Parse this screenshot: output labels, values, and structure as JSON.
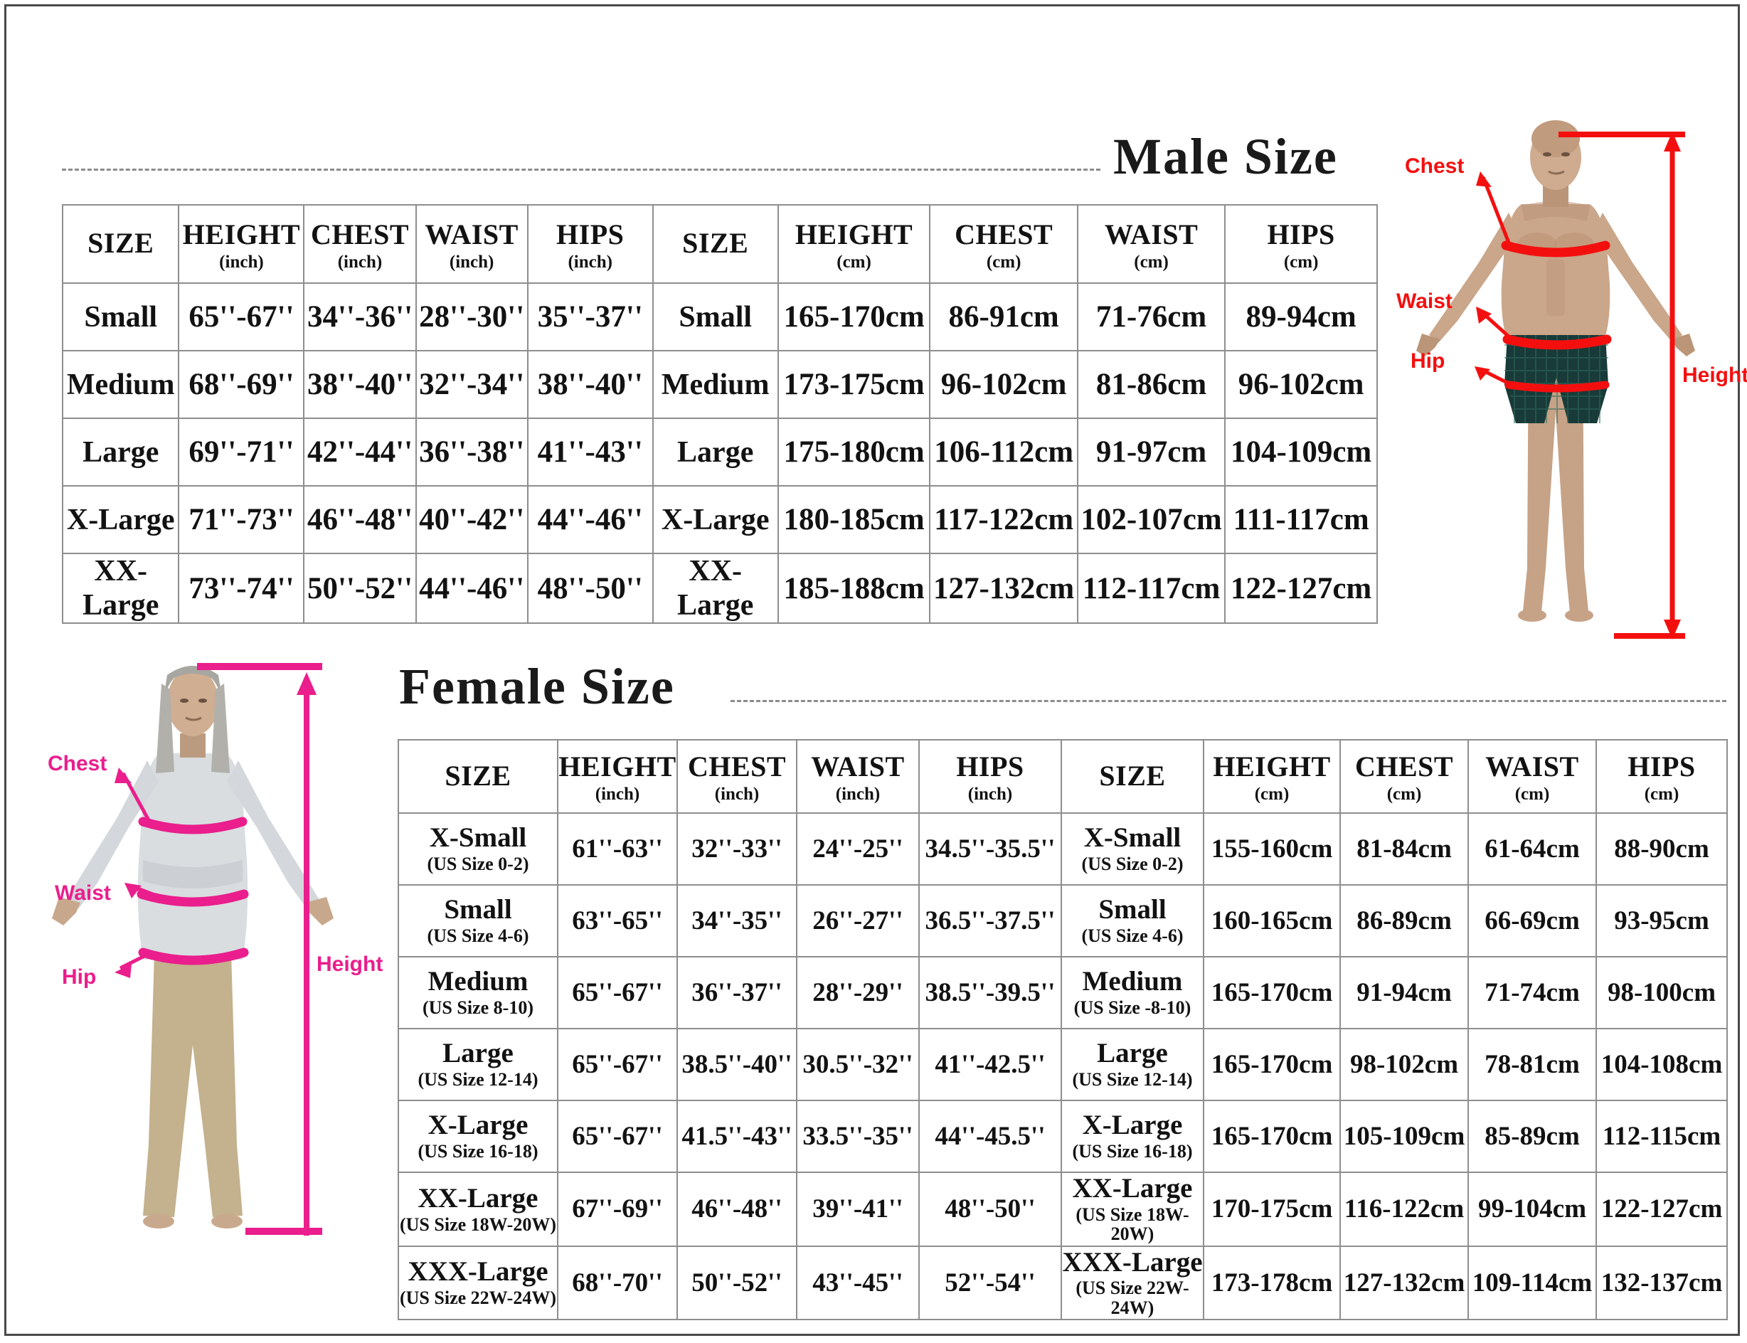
{
  "male": {
    "title": "Male Size",
    "headers_inch": [
      {
        "main": "SIZE",
        "unit": ""
      },
      {
        "main": "HEIGHT",
        "unit": "(inch)"
      },
      {
        "main": "CHEST",
        "unit": "(inch)"
      },
      {
        "main": "WAIST",
        "unit": "(inch)"
      },
      {
        "main": "HIPS",
        "unit": "(inch)"
      }
    ],
    "headers_cm": [
      {
        "main": "SIZE",
        "unit": ""
      },
      {
        "main": "HEIGHT",
        "unit": "(cm)"
      },
      {
        "main": "CHEST",
        "unit": "(cm)"
      },
      {
        "main": "WAIST",
        "unit": "(cm)"
      },
      {
        "main": "HIPS",
        "unit": "(cm)"
      }
    ],
    "rows": [
      {
        "size": "Small",
        "height_in": "65''-67''",
        "chest_in": "34''-36''",
        "waist_in": "28''-30''",
        "hips_in": "35''-37''",
        "size2": "Small",
        "height_cm": "165-170cm",
        "chest_cm": "86-91cm",
        "waist_cm": "71-76cm",
        "hips_cm": "89-94cm"
      },
      {
        "size": "Medium",
        "height_in": "68''-69''",
        "chest_in": "38''-40''",
        "waist_in": "32''-34''",
        "hips_in": "38''-40''",
        "size2": "Medium",
        "height_cm": "173-175cm",
        "chest_cm": "96-102cm",
        "waist_cm": "81-86cm",
        "hips_cm": "96-102cm"
      },
      {
        "size": "Large",
        "height_in": "69''-71''",
        "chest_in": "42''-44''",
        "waist_in": "36''-38''",
        "hips_in": "41''-43''",
        "size2": "Large",
        "height_cm": "175-180cm",
        "chest_cm": "106-112cm",
        "waist_cm": "91-97cm",
        "hips_cm": "104-109cm"
      },
      {
        "size": "X-Large",
        "height_in": "71''-73''",
        "chest_in": "46''-48''",
        "waist_in": "40''-42''",
        "hips_in": "44''-46''",
        "size2": "X-Large",
        "height_cm": "180-185cm",
        "chest_cm": "117-122cm",
        "waist_cm": "102-107cm",
        "hips_cm": "111-117cm"
      },
      {
        "size": "XX-Large",
        "height_in": "73''-74''",
        "chest_in": "50''-52''",
        "waist_in": "44''-46''",
        "hips_in": "48''-50''",
        "size2": "XX-Large",
        "height_cm": "185-188cm",
        "chest_cm": "127-132cm",
        "waist_cm": "112-117cm",
        "hips_cm": "122-127cm"
      }
    ],
    "figure": {
      "labels": {
        "chest": "Chest",
        "waist": "Waist",
        "hip": "Hip",
        "height": "Height"
      },
      "accent_color": "#f40f0f"
    }
  },
  "female": {
    "title": "Female Size",
    "headers_inch": [
      {
        "main": "SIZE",
        "unit": ""
      },
      {
        "main": "HEIGHT",
        "unit": "(inch)"
      },
      {
        "main": "CHEST",
        "unit": "(inch)"
      },
      {
        "main": "WAIST",
        "unit": "(inch)"
      },
      {
        "main": "HIPS",
        "unit": "(inch)"
      }
    ],
    "headers_cm": [
      {
        "main": "SIZE",
        "unit": ""
      },
      {
        "main": "HEIGHT",
        "unit": "(cm)"
      },
      {
        "main": "CHEST",
        "unit": "(cm)"
      },
      {
        "main": "WAIST",
        "unit": "(cm)"
      },
      {
        "main": "HIPS",
        "unit": "(cm)"
      }
    ],
    "rows": [
      {
        "size": "X-Small",
        "size_sub": "(US Size 0-2)",
        "height_in": "61''-63''",
        "chest_in": "32''-33''",
        "waist_in": "24''-25''",
        "hips_in": "34.5''-35.5''",
        "size2": "X-Small",
        "size2_sub": "(US Size 0-2)",
        "height_cm": "155-160cm",
        "chest_cm": "81-84cm",
        "waist_cm": "61-64cm",
        "hips_cm": "88-90cm"
      },
      {
        "size": "Small",
        "size_sub": "(US Size 4-6)",
        "height_in": "63''-65''",
        "chest_in": "34''-35''",
        "waist_in": "26''-27''",
        "hips_in": "36.5''-37.5''",
        "size2": "Small",
        "size2_sub": "(US Size 4-6)",
        "height_cm": "160-165cm",
        "chest_cm": "86-89cm",
        "waist_cm": "66-69cm",
        "hips_cm": "93-95cm"
      },
      {
        "size": "Medium",
        "size_sub": "(US Size 8-10)",
        "height_in": "65''-67''",
        "chest_in": "36''-37''",
        "waist_in": "28''-29''",
        "hips_in": "38.5''-39.5''",
        "size2": "Medium",
        "size2_sub": "(US Size -8-10)",
        "height_cm": "165-170cm",
        "chest_cm": "91-94cm",
        "waist_cm": "71-74cm",
        "hips_cm": "98-100cm"
      },
      {
        "size": "Large",
        "size_sub": "(US Size 12-14)",
        "height_in": "65''-67''",
        "chest_in": "38.5''-40''",
        "waist_in": "30.5''-32''",
        "hips_in": "41''-42.5''",
        "size2": "Large",
        "size2_sub": "(US Size 12-14)",
        "height_cm": "165-170cm",
        "chest_cm": "98-102cm",
        "waist_cm": "78-81cm",
        "hips_cm": "104-108cm"
      },
      {
        "size": "X-Large",
        "size_sub": "(US Size 16-18)",
        "height_in": "65''-67''",
        "chest_in": "41.5''-43''",
        "waist_in": "33.5''-35''",
        "hips_in": "44''-45.5''",
        "size2": "X-Large",
        "size2_sub": "(US Size 16-18)",
        "height_cm": "165-170cm",
        "chest_cm": "105-109cm",
        "waist_cm": "85-89cm",
        "hips_cm": "112-115cm"
      },
      {
        "size": "XX-Large",
        "size_sub": "(US Size 18W-20W)",
        "height_in": "67''-69''",
        "chest_in": "46''-48''",
        "waist_in": "39''-41''",
        "hips_in": "48''-50''",
        "size2": "XX-Large",
        "size2_sub": "(US Size 18W-20W)",
        "height_cm": "170-175cm",
        "chest_cm": "116-122cm",
        "waist_cm": "99-104cm",
        "hips_cm": "122-127cm"
      },
      {
        "size": "XXX-Large",
        "size_sub": "(US Size 22W-24W)",
        "height_in": "68''-70''",
        "chest_in": "50''-52''",
        "waist_in": "43''-45''",
        "hips_in": "52''-54''",
        "size2": "XXX-Large",
        "size2_sub": "(US Size 22W-24W)",
        "height_cm": "173-178cm",
        "chest_cm": "127-132cm",
        "waist_cm": "109-114cm",
        "hips_cm": "132-137cm"
      }
    ],
    "figure": {
      "labels": {
        "chest": "Chest",
        "waist": "Waist",
        "hip": "Hip",
        "height": "Height"
      },
      "accent_color": "#ea1e8c"
    }
  }
}
